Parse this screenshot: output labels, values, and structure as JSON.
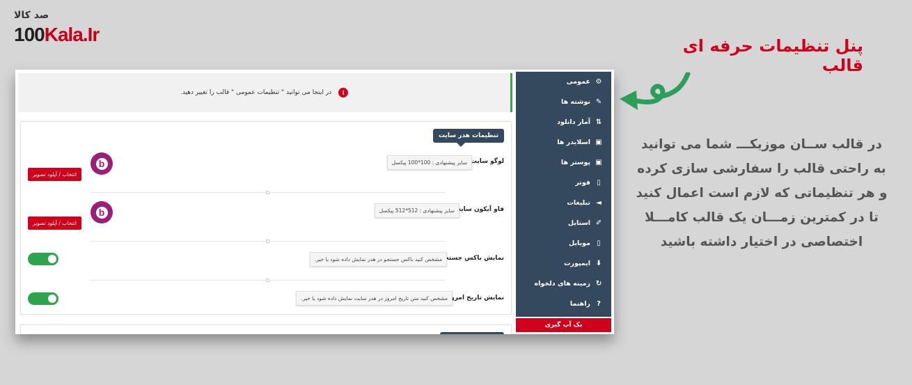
{
  "logo": {
    "persian": "صد کالا",
    "prefix": "100",
    "brand": "Kala.Ir"
  },
  "headline": "پنل تنظیمات حرفه ای قالب",
  "description": [
    "در قالب ســان موزیکـــ شما می توانید",
    "به راحتی  قالب  را سفارشی سازی کرده",
    "و هر تنظیماتی که لازم است اعمال کنید",
    "تا  در کمترین زمـــان یک  قالب کامـــلا",
    "اختصاصی در اختیار داشته باشید"
  ],
  "sidebar": {
    "items": [
      {
        "label": "عمومی",
        "icon": "cogs-icon",
        "glyph": "⚙"
      },
      {
        "label": "نوشته ها",
        "icon": "edit-icon",
        "glyph": "✎"
      },
      {
        "label": "آمار دانلود",
        "icon": "sort-icon",
        "glyph": "⇅"
      },
      {
        "label": "اسلایدر ها",
        "icon": "image-icon",
        "glyph": "▣"
      },
      {
        "label": "پوستر ها",
        "icon": "image-icon",
        "glyph": "▣"
      },
      {
        "label": "فوتر",
        "icon": "mobile-icon",
        "glyph": "▯"
      },
      {
        "label": "تبلیغات",
        "icon": "bullhorn-icon",
        "glyph": "◄"
      },
      {
        "label": "استایل",
        "icon": "brush-icon",
        "glyph": "✐"
      },
      {
        "label": "موبایل",
        "icon": "mobile-icon",
        "glyph": "▯"
      },
      {
        "label": "ایمپورت",
        "icon": "download-icon",
        "glyph": "⬇"
      },
      {
        "label": "زمینه های دلخواه",
        "icon": "refresh-icon",
        "glyph": "↻"
      },
      {
        "label": "راهنما",
        "icon": "help-icon",
        "glyph": "?"
      }
    ],
    "backup_label": "بک آپ گیری"
  },
  "notice": {
    "text": "در اینجا می توانید \" تنظیمات عمومی \" قالب را تغییر دهید.",
    "icon_glyph": "i"
  },
  "panel": {
    "title": "تنظیمات هدر سایت",
    "logo_row": {
      "label": "لوگو سایت :",
      "hint": "سایز پیشنهادی : 100*100 پیکسل",
      "button": "انتخاب / آپلود تصویر"
    },
    "favicon_row": {
      "label": "فاو آیکون سایت :",
      "hint": "سایز پیشنهادی : 512*512 پیکسل",
      "button": "انتخاب / آپلود تصویر"
    },
    "search_row": {
      "label": "نمایش باکس جستجو :",
      "hint": "مشخص کنید باکس جستجو در هدر نمایش داده شود یا خیر.",
      "enabled": true
    },
    "date_row": {
      "label": "نمایش تاریخ امروز :",
      "hint": "مشخص کنید متن تاریخ امروز در هدر سایت نمایش داده شود یا خیر.",
      "enabled": true
    }
  },
  "colors": {
    "sidebar": "#34495e",
    "accent_red": "#d0021b",
    "toggle_green": "#2ea44f",
    "headline": "#d0021b",
    "arrow": "#2e9e5b"
  }
}
